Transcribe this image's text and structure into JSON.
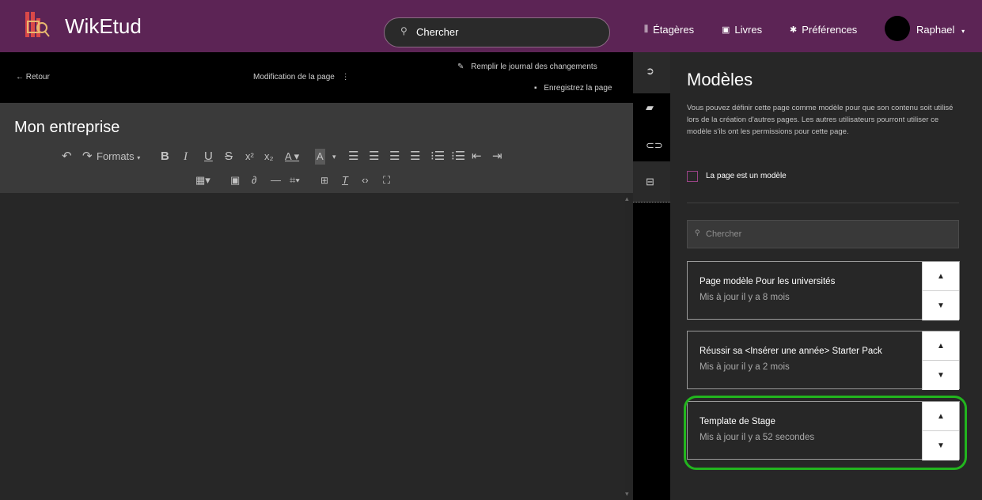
{
  "header": {
    "app_title": "WikEtud",
    "search_placeholder": "Chercher",
    "nav": [
      {
        "label": "Étagères",
        "icon": "shelves-icon"
      },
      {
        "label": "Livres",
        "icon": "book-icon"
      },
      {
        "label": "Préférences",
        "icon": "gear-icon"
      }
    ],
    "user": {
      "name": "Raphael",
      "icon": "chevron-down-icon"
    }
  },
  "editor": {
    "back_label": "← Retour",
    "editing_label": "Modification de la page",
    "menu_icon": "kebab-menu-icon",
    "changelog_label": "Remplir le journal des changements",
    "save_label": "Enregistrez la page",
    "page_name": "Mon entreprise",
    "toolbar": {
      "formats_label": "Formats"
    }
  },
  "side_icons": [
    "circle-arrow-icon",
    "tag-icon",
    "paperclip-icon",
    "template-icon"
  ],
  "panel": {
    "title": "Modèles",
    "description": "Vous pouvez définir cette page comme modèle pour que son contenu soit utilisé lors de la création d'autres pages. Les autres utilisateurs pourront utiliser ce modèle s'ils ont les permissions pour cette page.",
    "checkbox_label": "La page est un modèle",
    "search_placeholder": "Chercher",
    "templates": [
      {
        "name": "Page modèle Pour les universités",
        "meta": "Mis à jour il y a 8 mois"
      },
      {
        "name": "Réussir sa <Insérer une année> Starter Pack",
        "meta": "Mis à jour il y a 2 mois"
      },
      {
        "name": "Template de Stage",
        "meta": "Mis à jour il y a 52 secondes"
      }
    ]
  },
  "colors": {
    "header_bg": "#5c2455",
    "highlight": "#22b51e",
    "accent": "#9a4386"
  }
}
